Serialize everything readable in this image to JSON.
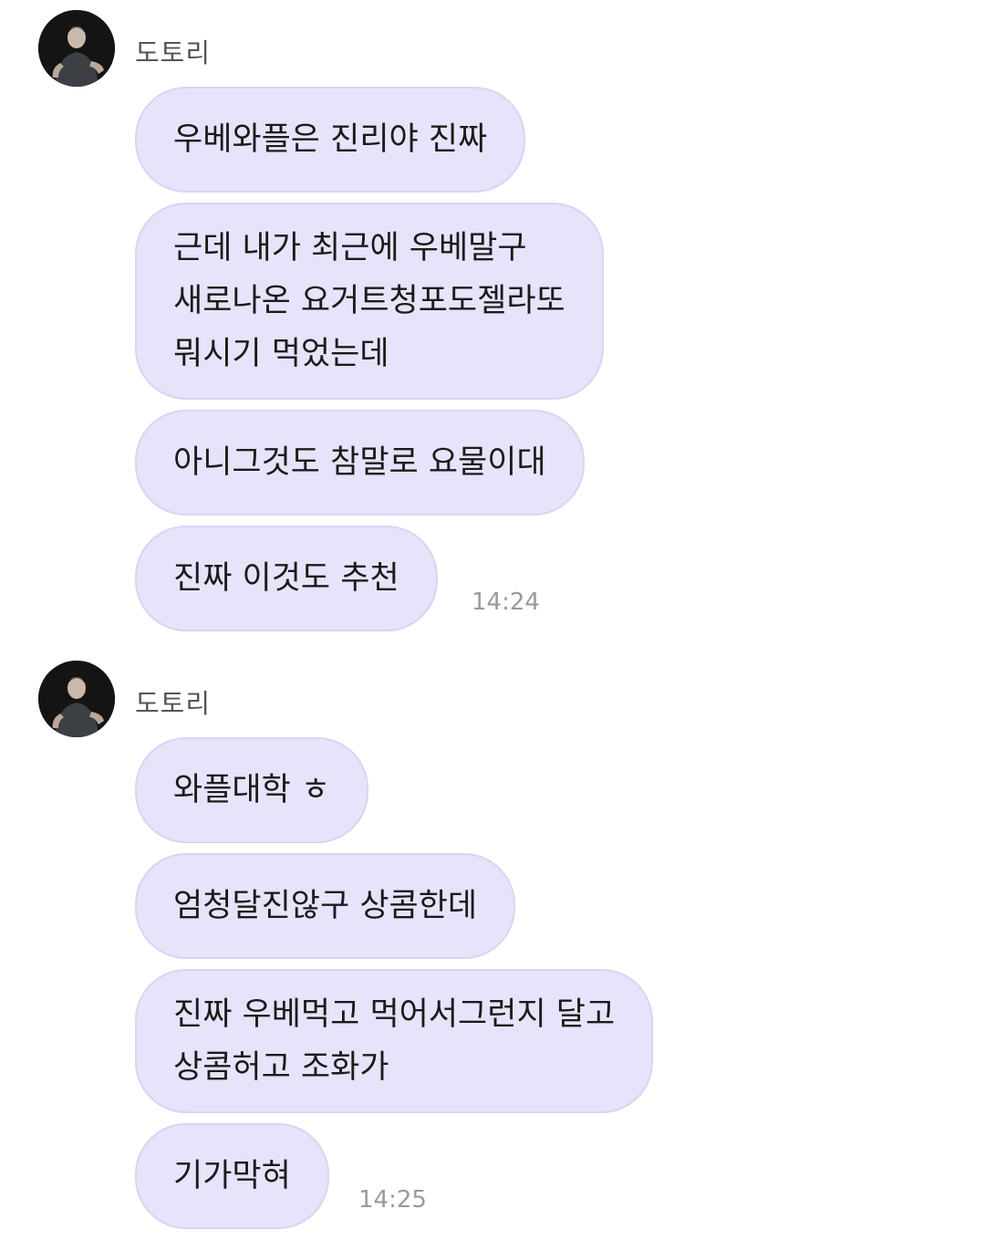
{
  "chat": {
    "groups": [
      {
        "sender": "도토리",
        "messages": [
          "우베와플은 진리야 진짜",
          "근데 내가 최근에 우베말구\n새로나온 요거트청포도젤라또\n뭐시기 먹었는데",
          "아니그것도 참말로 요물이대",
          "진짜 이것도 추천"
        ],
        "time": "14:24"
      },
      {
        "sender": "도토리",
        "messages": [
          "와플대학 ㅎ",
          "엄청달진않구 상콤한데",
          "진짜 우베먹고 먹어서그런지 달고\n상콤허고 조화가",
          "기가막혀"
        ],
        "time": "14:25"
      }
    ]
  },
  "icons": {
    "avatar": "profile-photo"
  },
  "colors": {
    "bubble": "#e6e4fa",
    "bubble_border": "#d8d5f2",
    "timestamp": "#9a9a9a",
    "sender": "#555555"
  }
}
